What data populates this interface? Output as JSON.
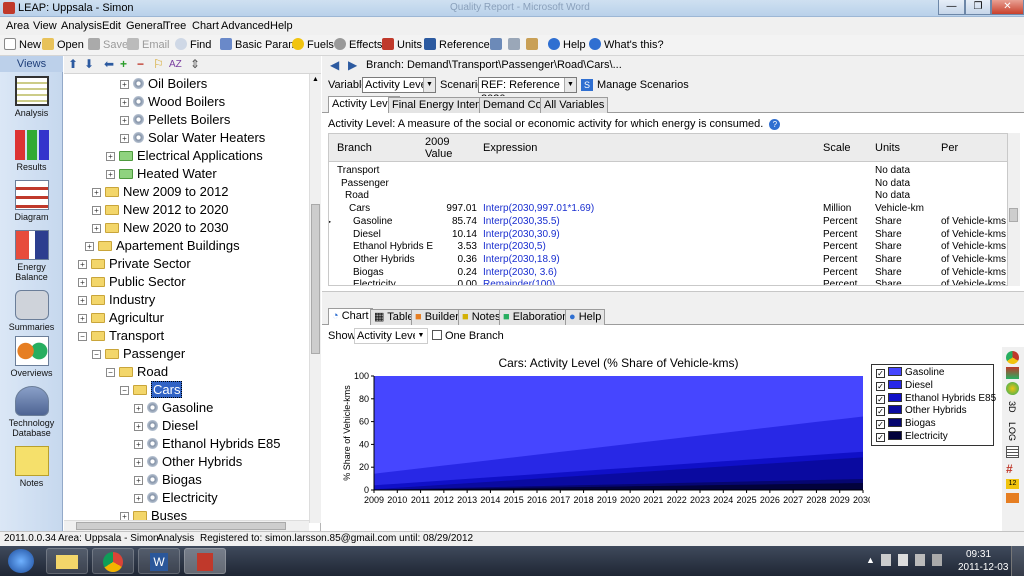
{
  "window": {
    "title": "LEAP: Uppsala - Simon",
    "ghost_title": "Quality Report - Microsoft Word",
    "minimize": "—",
    "restore": "❐",
    "close": "✕"
  },
  "menu": [
    "Area",
    "View",
    "Analysis",
    "Edit",
    "General",
    "Tree",
    "Chart",
    "Advanced",
    "Help"
  ],
  "toolbar": {
    "new": "New",
    "open": "Open",
    "save": "Save",
    "email": "Email",
    "find": "Find",
    "basic_params": "Basic Params",
    "fuels": "Fuels",
    "effects": "Effects",
    "units": "Units",
    "references": "References",
    "help": "Help",
    "whats_this": "What's this?"
  },
  "views": {
    "header": "Views",
    "items": [
      "Analysis",
      "Results",
      "Diagram",
      "Energy Balance",
      "Summaries",
      "Overviews",
      "Technology Database",
      "Notes"
    ]
  },
  "tree": [
    {
      "label": "Oil Boilers",
      "icon": "gear",
      "indent": 3
    },
    {
      "label": "Wood Boilers",
      "icon": "gear",
      "indent": 3
    },
    {
      "label": "Pellets Boilers",
      "icon": "gear",
      "indent": 3
    },
    {
      "label": "Solar Water Heaters",
      "icon": "gear",
      "indent": 3
    },
    {
      "label": "Electrical Applications",
      "icon": "folder-green",
      "indent": 2
    },
    {
      "label": "Heated Water",
      "icon": "folder-green",
      "indent": 2
    },
    {
      "label": "New 2009 to 2012",
      "icon": "folder",
      "indent": 1
    },
    {
      "label": "New 2012 to 2020",
      "icon": "folder",
      "indent": 1
    },
    {
      "label": "New 2020 to 2030",
      "icon": "folder",
      "indent": 1
    },
    {
      "label": "Apartement Buildings",
      "icon": "folder",
      "indent": 0.5
    },
    {
      "label": "Private Sector",
      "icon": "folder",
      "indent": 0
    },
    {
      "label": "Public Sector",
      "icon": "folder",
      "indent": 0
    },
    {
      "label": "Industry",
      "icon": "folder",
      "indent": 0
    },
    {
      "label": "Agricultur",
      "icon": "folder",
      "indent": 0
    },
    {
      "label": "Transport",
      "icon": "folder",
      "indent": 0
    },
    {
      "label": "Passenger",
      "icon": "folder",
      "indent": 1
    },
    {
      "label": "Road",
      "icon": "folder",
      "indent": 2
    },
    {
      "label": "Cars",
      "icon": "folder",
      "indent": 3,
      "selected": true
    },
    {
      "label": "Gasoline",
      "icon": "gear",
      "indent": 4
    },
    {
      "label": "Diesel",
      "icon": "gear",
      "indent": 4
    },
    {
      "label": "Ethanol Hybrids E85",
      "icon": "gear",
      "indent": 4
    },
    {
      "label": "Other Hybrids",
      "icon": "gear",
      "indent": 4
    },
    {
      "label": "Biogas",
      "icon": "gear",
      "indent": 4
    },
    {
      "label": "Electricity",
      "icon": "gear",
      "indent": 4
    },
    {
      "label": "Buses",
      "icon": "folder",
      "indent": 3
    }
  ],
  "main": {
    "branch_label": "Branch: Demand\\Transport\\Passenger\\Road\\Cars\\...",
    "variable_label": "Variable:",
    "variable_value": "Activity Level",
    "scenario_label": "Scenario:",
    "scenario_value": "REF: Reference 2030",
    "manage": "Manage Scenarios",
    "tabs": [
      "Activity Level",
      "Final Energy Intensity",
      "Demand Cost",
      "All Variables"
    ],
    "description": "Activity Level: A measure of the social or economic activity for which energy is consumed.",
    "columns": {
      "branch": "Branch",
      "value_top": "2009",
      "value_bottom": "Value",
      "expression": "Expression",
      "scale": "Scale",
      "units": "Units",
      "per": "Per"
    },
    "rows": [
      {
        "branch": "Transport",
        "value": "",
        "expr": "",
        "scale": "",
        "units": "No data",
        "per": "",
        "indent": 0
      },
      {
        "branch": "Passenger",
        "value": "",
        "expr": "",
        "scale": "",
        "units": "No data",
        "per": "",
        "indent": 1
      },
      {
        "branch": "Road",
        "value": "",
        "expr": "",
        "scale": "",
        "units": "No data",
        "per": "",
        "indent": 2
      },
      {
        "branch": "Cars",
        "value": "997.01",
        "expr": "Interp(2030,997.01*1.69)",
        "scale": "Million",
        "units": "Vehicle-km",
        "per": "",
        "indent": 3
      },
      {
        "branch": "Gasoline",
        "value": "85.74",
        "expr": "Interp(2030,35.5)",
        "scale": "Percent",
        "units": "Share",
        "per": "of Vehicle-kms",
        "indent": 4
      },
      {
        "branch": "Diesel",
        "value": "10.14",
        "expr": "Interp(2030,30.9)",
        "scale": "Percent",
        "units": "Share",
        "per": "of Vehicle-kms",
        "indent": 4
      },
      {
        "branch": "Ethanol Hybrids E",
        "value": "3.53",
        "expr": "Interp(2030,5)",
        "scale": "Percent",
        "units": "Share",
        "per": "of Vehicle-kms",
        "indent": 4
      },
      {
        "branch": "Other Hybrids",
        "value": "0.36",
        "expr": "Interp(2030,18.9)",
        "scale": "Percent",
        "units": "Share",
        "per": "of Vehicle-kms",
        "indent": 4
      },
      {
        "branch": "Biogas",
        "value": "0.24",
        "expr": "Interp(2030, 3.6)",
        "scale": "Percent",
        "units": "Share",
        "per": "of Vehicle-kms",
        "indent": 4
      },
      {
        "branch": "Electricity",
        "value": "0.00",
        "expr": "Remainder(100)",
        "scale": "Percent",
        "units": "Share",
        "per": "of Vehicle-kms",
        "indent": 4
      }
    ],
    "bottom_tabs": [
      "Chart",
      "Table",
      "Builder",
      "Notes",
      "Elaboration",
      "Help"
    ],
    "show_label": "Show:",
    "show_value": "Activity Level",
    "one_branch": "One Branch",
    "right_tools": [
      "3D",
      "LOG"
    ]
  },
  "chart_data": {
    "type": "area",
    "stacked": true,
    "title": "Cars: Activity Level (% Share of Vehicle-kms)",
    "ylabel": "% Share of Vehicle-kms",
    "xlabel": "",
    "ylim": [
      0,
      100
    ],
    "yticks": [
      0,
      20,
      40,
      60,
      80,
      100
    ],
    "x": [
      2009,
      2010,
      2011,
      2012,
      2013,
      2014,
      2015,
      2016,
      2017,
      2018,
      2019,
      2020,
      2021,
      2022,
      2023,
      2024,
      2025,
      2026,
      2027,
      2028,
      2029,
      2030
    ],
    "series": [
      {
        "name": "Gasoline",
        "start": 85.74,
        "end": 35.5,
        "color": "#4646ff"
      },
      {
        "name": "Diesel",
        "start": 10.14,
        "end": 30.9,
        "color": "#2828e6"
      },
      {
        "name": "Ethanol Hybrids E85",
        "start": 3.53,
        "end": 5,
        "color": "#1010c8"
      },
      {
        "name": "Other Hybrids",
        "start": 0.36,
        "end": 18.9,
        "color": "#0a0aa0"
      },
      {
        "name": "Biogas",
        "start": 0.24,
        "end": 3.6,
        "color": "#060670"
      },
      {
        "name": "Electricity",
        "start": 0.0,
        "end": 6.1,
        "color": "#02023c"
      }
    ]
  },
  "status": {
    "version": "2011.0.0.34",
    "area": "Area: Uppsala - Simon",
    "view": "Analysis",
    "registered": "Registered to: simon.larsson.85@gmail.com until: 08/29/2012"
  },
  "taskbar": {
    "time": "09:31",
    "date": "2011-12-03"
  }
}
